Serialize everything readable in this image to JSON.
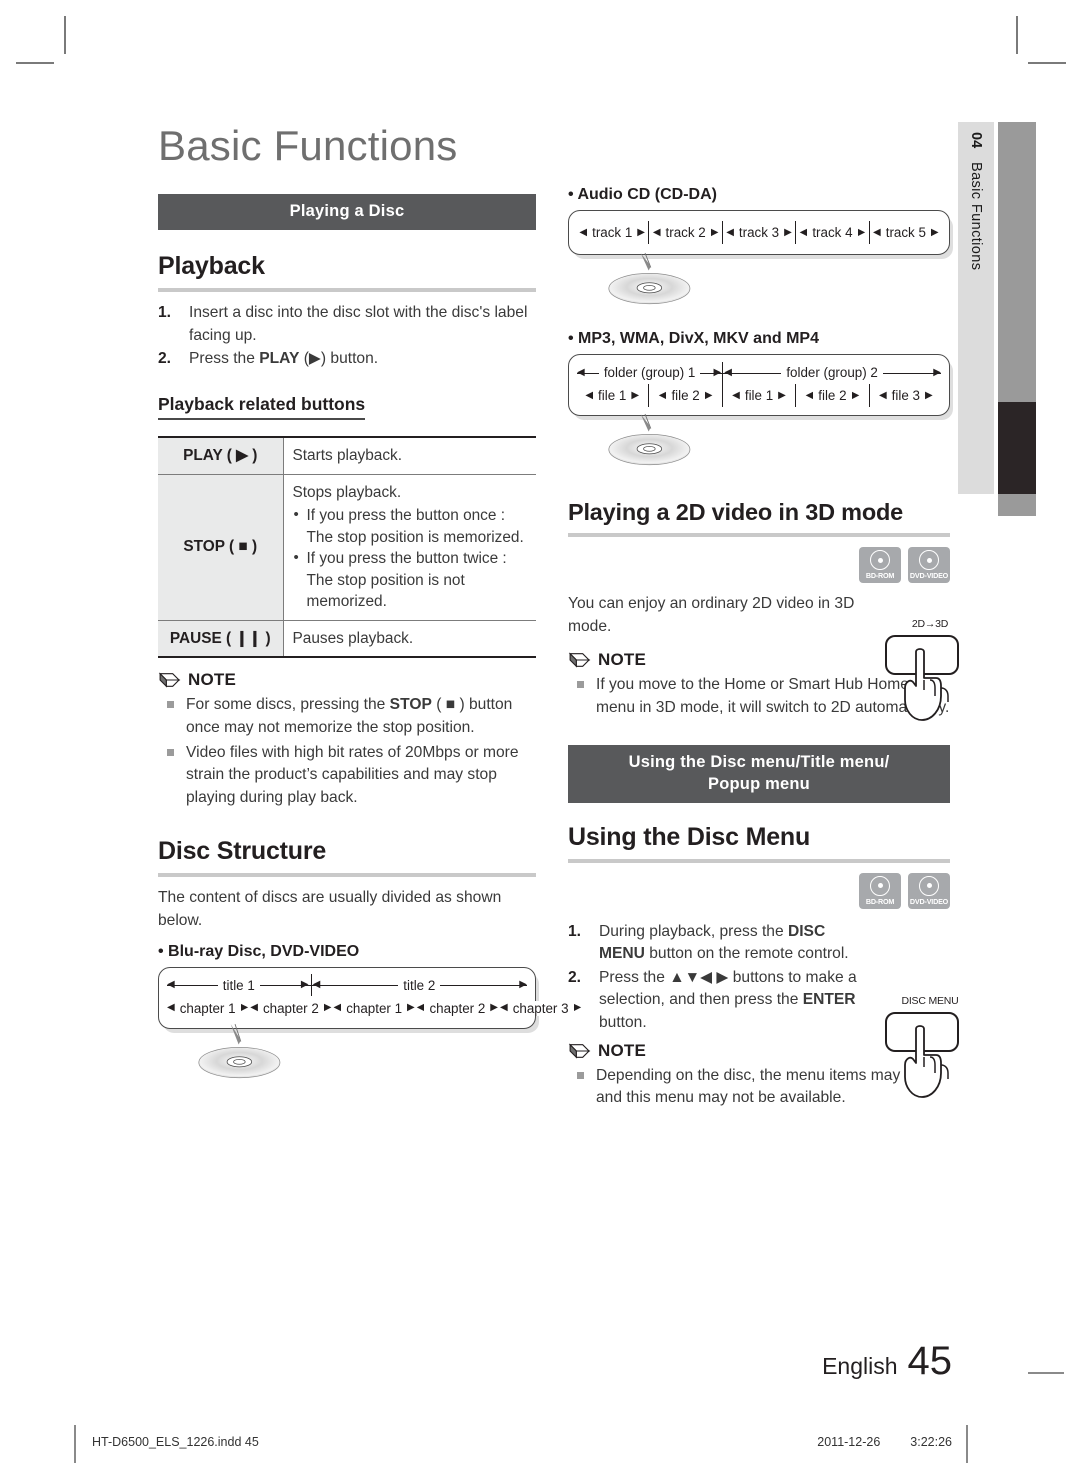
{
  "page": {
    "title": "Basic Functions",
    "chapter_number": "04",
    "chapter_name": "Basic Functions",
    "language": "English",
    "page_number": "45",
    "file_name": "HT-D6500_ELS_1226.indd   45",
    "print_date": "2011-12-26",
    "print_time": "3:22:26"
  },
  "colors": {
    "band_bg": "#58595b",
    "tab_bar_gray": "#9a9a9a",
    "tab_bar_dark": "#2b2526",
    "tab_label_bg": "#dcdcdc",
    "rule_gray": "#c9c9c9",
    "table_key_bg": "#e9eaea",
    "badge_bg": "#a7a9ac"
  },
  "left": {
    "section_band": "Playing a Disc",
    "playback": {
      "heading": "Playback",
      "steps": [
        {
          "num": "1.",
          "pre": "Insert a disc into the disc slot with the disc's label facing up.",
          "bold": "",
          "post": ""
        },
        {
          "num": "2.",
          "pre": "Press the ",
          "bold": "PLAY",
          "post": " (▶) button."
        }
      ]
    },
    "related_buttons": {
      "heading": "Playback related buttons",
      "rows": [
        {
          "key": "PLAY ( ▶ )",
          "desc": "Starts playback.",
          "bullets": []
        },
        {
          "key": "STOP ( ■ )",
          "desc": "Stops playback.",
          "bullets": [
            "If you press the button once : The stop position is memorized.",
            "If you press the button twice : The stop position is not memorized."
          ]
        },
        {
          "key": "PAUSE ( ❙❙ )",
          "desc": "Pauses playback.",
          "bullets": []
        }
      ]
    },
    "note": {
      "label": "NOTE",
      "items": [
        {
          "pre": "For some discs, pressing the ",
          "bold": "STOP",
          "post": " ( ■ ) button once may not memorize the stop position."
        },
        {
          "pre": "Video files with high bit rates of 20Mbps or more strain the product’s capabilities and may stop playing during play back.",
          "bold": "",
          "post": ""
        }
      ]
    },
    "disc_structure": {
      "heading": "Disc Structure",
      "intro": "The content of discs are usually divided as shown below.",
      "bullet_heading": "Blu-ray Disc, DVD-VIDEO",
      "titles": [
        "title 1",
        "title 2"
      ],
      "chapters_title1": [
        "chapter 1",
        "chapter 2"
      ],
      "chapters_title2": [
        "chapter 1",
        "chapter 2",
        "chapter 3"
      ]
    }
  },
  "right": {
    "audio_cd": {
      "bullet_heading": "Audio CD (CD-DA)",
      "tracks": [
        "track 1",
        "track 2",
        "track 3",
        "track 4",
        "track 5"
      ]
    },
    "media_files": {
      "bullet_heading": "MP3, WMA, DivX, MKV and MP4",
      "folders": [
        "folder (group) 1",
        "folder (group) 2"
      ],
      "files_folder1": [
        "file 1",
        "file 2"
      ],
      "files_folder2": [
        "file 1",
        "file 2",
        "file 3"
      ]
    },
    "two_d_three_d": {
      "heading": "Playing a 2D video in 3D mode",
      "badges": [
        "BD-ROM",
        "DVD-VIDEO"
      ],
      "body": "You can enjoy an ordinary 2D video in 3D mode.",
      "key_label": "2D→3D",
      "note": {
        "label": "NOTE",
        "items": [
          "If you move to the Home or Smart Hub Home menu in 3D mode, it will switch to 2D automatically."
        ]
      }
    },
    "disc_menu": {
      "band_line1": "Using the Disc menu/Title menu/",
      "band_line2": "Popup menu",
      "heading": "Using the Disc Menu",
      "badges": [
        "BD-ROM",
        "DVD-VIDEO"
      ],
      "key_label": "DISC MENU",
      "steps": [
        {
          "num": "1.",
          "pre": "During playback, press the ",
          "bold": "DISC MENU",
          "post": "  button on the remote control."
        },
        {
          "num": "2.",
          "pre": "Press the ▲▼◀ ▶ buttons to make a selection, and then press the ",
          "bold": "ENTER",
          "post": " button."
        }
      ],
      "note": {
        "label": "NOTE",
        "items": [
          "Depending on the disc, the menu items may differ and this menu may not be available."
        ]
      }
    }
  }
}
